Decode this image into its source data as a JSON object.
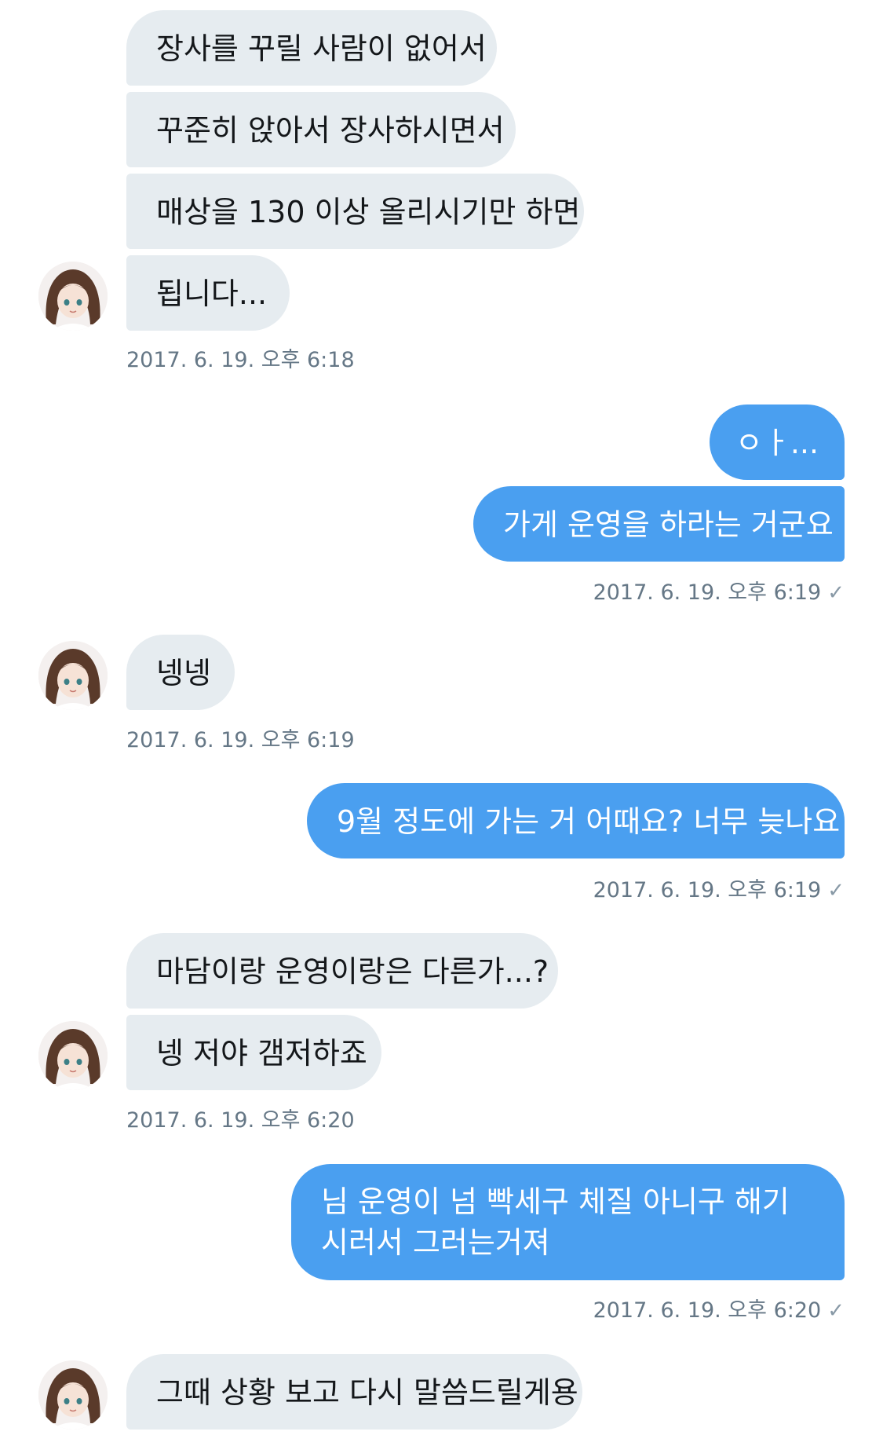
{
  "messages": [
    {
      "text": "장사를 꾸릴 사람이 없어서"
    },
    {
      "text": "꾸준히 앉아서 장사하시면서"
    },
    {
      "text": "매상을 130 이상 올리시기만 하면"
    },
    {
      "text": "됩니다..."
    },
    {
      "text": "ㅇㅏ..."
    },
    {
      "text": "가게 운영을 하라는 거군요"
    },
    {
      "text": "넹넹"
    },
    {
      "text": "9월 정도에 가는 거 어때요? 너무 늦나요"
    },
    {
      "text": "마담이랑 운영이랑은 다른가...?"
    },
    {
      "text": "넹 저야 갬저하죠"
    },
    {
      "text": "님 운영이 넘 빡세구 체질 아니구 해기시러서 그러는거져"
    },
    {
      "text": "그때 상황 보고 다시 말씀드릴게용"
    }
  ],
  "timestamps": {
    "t1": "2017. 6. 19. 오후 6:18",
    "t2": "2017. 6. 19. 오후 6:19",
    "t3": "2017. 6. 19. 오후 6:19",
    "t4": "2017. 6. 19. 오후 6:19",
    "t5": "2017. 6. 19. 오후 6:20",
    "t6": "2017. 6. 19. 오후 6:20"
  },
  "read_receipt_icon": "checkmark-icon",
  "avatar_icon": "avatar-icon",
  "colors": {
    "incoming_bubble": "#e6ecf0",
    "outgoing_bubble": "#4a9ff0",
    "timestamp_text": "#657786"
  }
}
